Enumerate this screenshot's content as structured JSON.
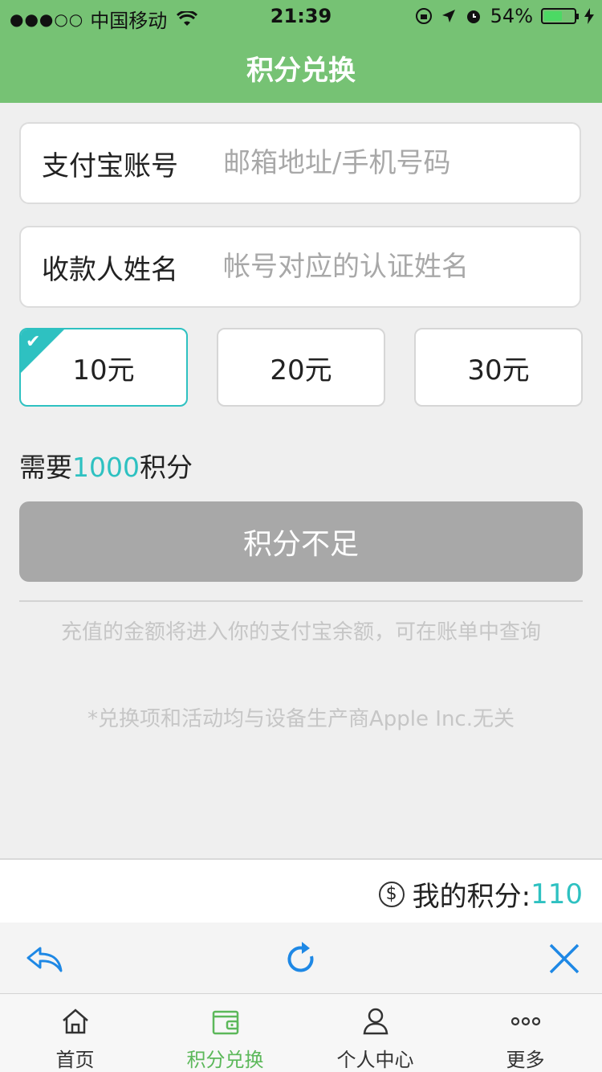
{
  "status_bar": {
    "signal": "●●●○○",
    "carrier": "中国移动",
    "time": "21:39",
    "battery": "54%"
  },
  "nav": {
    "title": "积分兑换"
  },
  "form": {
    "account_label": "支付宝账号",
    "account_placeholder": "邮箱地址/手机号码",
    "name_label": "收款人姓名",
    "name_placeholder": "帐号对应的认证姓名"
  },
  "amounts": [
    {
      "label": "10元",
      "selected": true
    },
    {
      "label": "20元",
      "selected": false
    },
    {
      "label": "30元",
      "selected": false
    }
  ],
  "requirement": {
    "prefix": "需要",
    "points": "1000",
    "suffix": "积分"
  },
  "submit_label": "积分不足",
  "notes": {
    "recharge": "充值的金额将进入你的支付宝余额，可在账单中查询",
    "disclaimer": "*兑换项和活动均与设备生产商Apple Inc.无关"
  },
  "my_points": {
    "label": "我的积分:",
    "value": "110"
  },
  "colors": {
    "theme_green": "#76c274",
    "accent_teal": "#2ec1c1",
    "disabled_gray": "#a8a8a8"
  },
  "tabs": [
    {
      "label": "首页",
      "icon": "home-icon",
      "active": false
    },
    {
      "label": "积分兑换",
      "icon": "wallet-icon",
      "active": true
    },
    {
      "label": "个人中心",
      "icon": "user-icon",
      "active": false
    },
    {
      "label": "更多",
      "icon": "more-icon",
      "active": false
    }
  ]
}
